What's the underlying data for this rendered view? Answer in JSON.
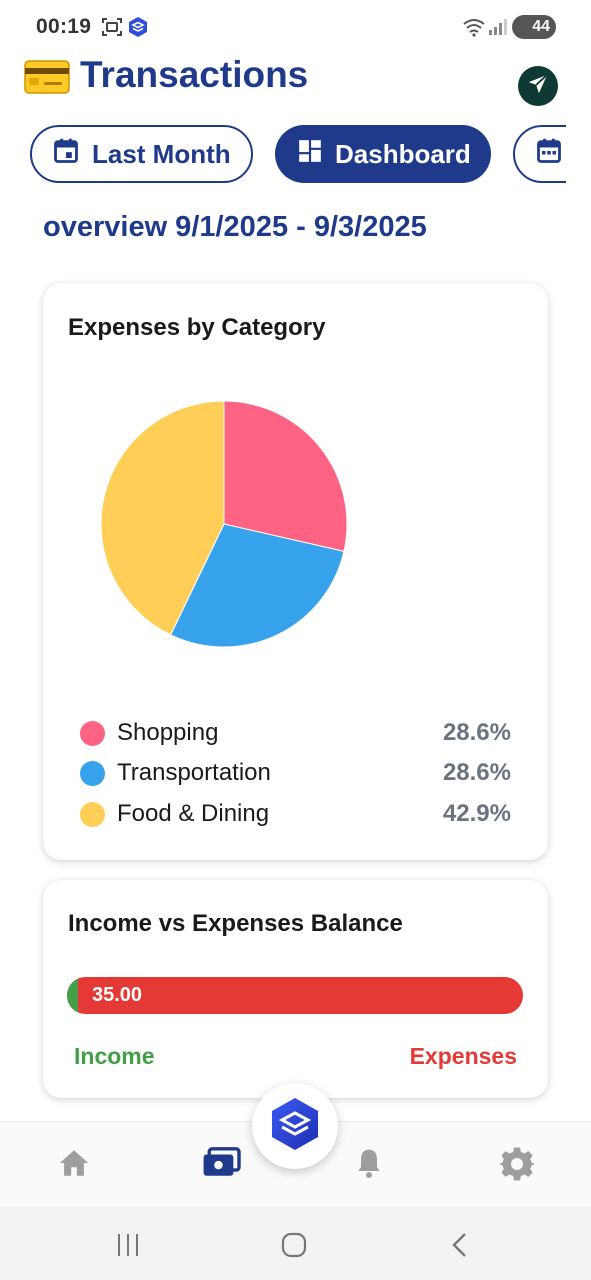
{
  "status": {
    "time": "00:19",
    "battery": "44"
  },
  "header": {
    "title": "Transactions"
  },
  "filters": [
    {
      "label": "Last Month",
      "active": false
    },
    {
      "label": "Dashboard",
      "active": true
    }
  ],
  "overview": "overview 9/1/2025 - 9/3/2025",
  "expenses_card": {
    "title": "Expenses by Category",
    "chart_data": {
      "type": "pie",
      "title": "Expenses by Category",
      "categories": [
        "Shopping",
        "Transportation",
        "Food & Dining"
      ],
      "values": [
        28.6,
        28.6,
        42.9
      ],
      "labels": [
        "28.6%",
        "28.6%",
        "42.9%"
      ],
      "colors": [
        "#ff6384",
        "#36a2eb",
        "#ffce56"
      ]
    }
  },
  "balance_card": {
    "title": "Income vs Expenses Balance",
    "bar_value": "35.00",
    "income_label": "Income",
    "expenses_label": "Expenses",
    "income_fraction": 0.025,
    "colors": {
      "income": "#43a047",
      "expenses": "#e53935"
    }
  },
  "bottom_nav": {
    "items": [
      "home-icon",
      "wallet-icon",
      "bell-icon",
      "gear-icon"
    ],
    "active": "wallet-icon",
    "fab_icon": "layers-icon"
  },
  "theme": {
    "accent": "#1f3a8a"
  }
}
